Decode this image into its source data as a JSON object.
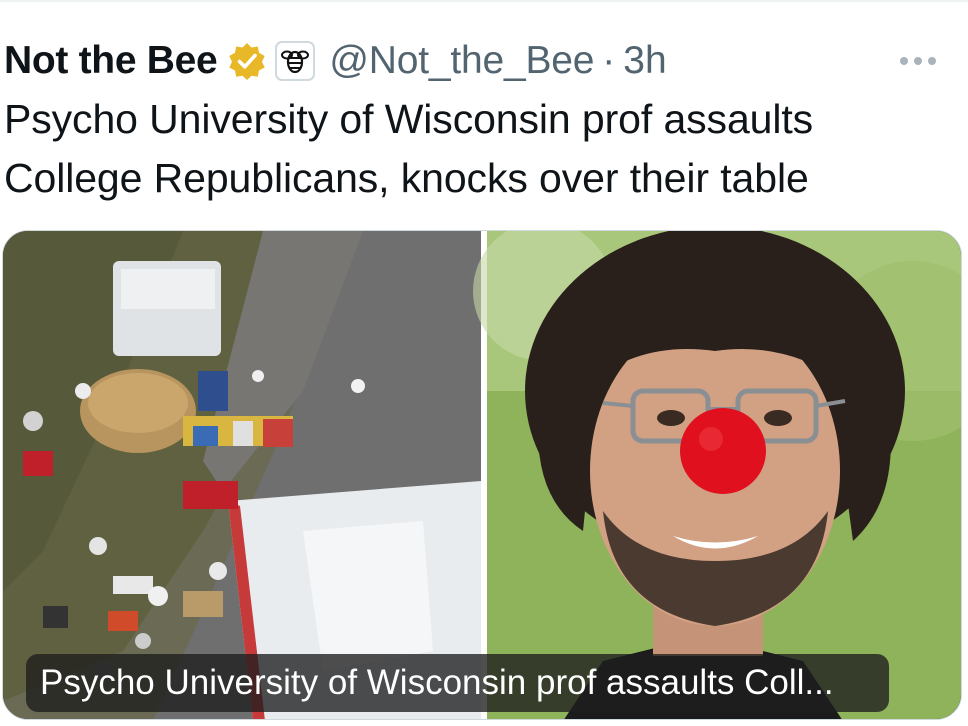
{
  "tweet": {
    "author_name": "Not the Bee",
    "verified_icon": "verified-badge-icon",
    "affiliate_icon": "babylon-bee-logo-icon",
    "handle": "@Not_the_Bee",
    "separator": "·",
    "time": "3h",
    "more_icon": "more-options-icon",
    "text_line1": "Psycho University of Wisconsin prof assaults",
    "text_line2": "College Republicans, knocks over their table"
  },
  "media": {
    "left_image": "scattered-table-items-photo",
    "right_image": "man-with-clown-nose-photo",
    "caption": "Psycho University of Wisconsin prof assaults Coll..."
  },
  "colors": {
    "text_primary": "#0f1419",
    "text_secondary": "#536471",
    "verified_gold": "#e8b829",
    "clown_nose_red": "#e0101e"
  }
}
